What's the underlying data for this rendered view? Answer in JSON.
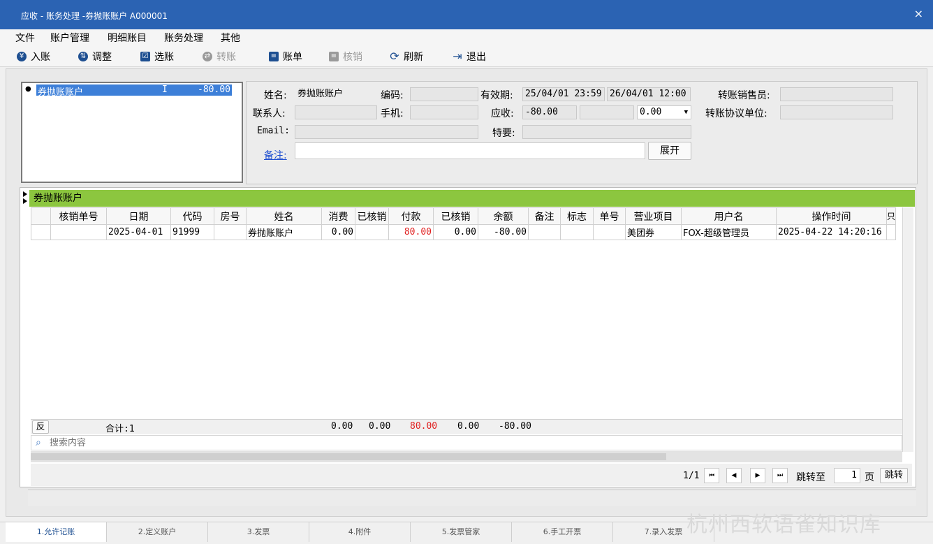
{
  "window": {
    "title": "应收 - 账务处理 -券抛账账户 A000001",
    "close": "×"
  },
  "menu": [
    "文件",
    "账户管理",
    "明细账目",
    "账务处理",
    "其他"
  ],
  "toolbar": [
    {
      "label": "入账",
      "glyph": "¥",
      "enabled": true
    },
    {
      "label": "调整",
      "glyph": "⇅",
      "enabled": true
    },
    {
      "label": "选账",
      "glyph": "☑",
      "enabled": true
    },
    {
      "label": "转账",
      "glyph": "⇄",
      "enabled": false
    },
    {
      "label": "账单",
      "glyph": "≡",
      "enabled": true
    },
    {
      "label": "核销",
      "glyph": "≡",
      "enabled": false
    },
    {
      "label": "刷新",
      "glyph": "⟳",
      "enabled": true
    },
    {
      "label": "退出",
      "glyph": "⇥",
      "enabled": true
    }
  ],
  "account_list": {
    "name": "券抛账账户",
    "flag": "I",
    "balance": "-80.00",
    "bullet": "●"
  },
  "info": {
    "name_label": "姓名:",
    "name_value": "券抛账账户",
    "code_label": "编码:",
    "code_value": "",
    "valid_label": "有效期:",
    "valid_from": "25/04/01 23:59",
    "valid_to": "26/04/01 12:00",
    "sales_label": "转账销售员:",
    "sales_value": "",
    "contact_label": "联系人:",
    "contact_value": "",
    "phone_label": "手机:",
    "phone_value": "",
    "receivable_label": "应收:",
    "receivable_value": "-80.00",
    "receivable_extra": "",
    "receivable_select": "0.00",
    "agreement_label": "转账协议单位:",
    "agreement_value": "",
    "email_label": "Email:",
    "email_value": "",
    "special_label": "特要:",
    "special_value": "",
    "remark_label": "备注:",
    "remark_value": "",
    "expand_button": "展开"
  },
  "grid": {
    "title": "券抛账账户",
    "columns": [
      "",
      "核销单号",
      "日期",
      "代码",
      "房号",
      "姓名",
      "消费",
      "已核销",
      "付款",
      "已核销",
      "余额",
      "备注",
      "标志",
      "单号",
      "营业项目",
      "用户名",
      "操作时间",
      "只"
    ],
    "rows": [
      [
        "",
        "",
        "2025-04-01",
        "91999",
        "",
        "券抛账账户",
        "0.00",
        "",
        "80.00",
        "0.00",
        "-80.00",
        "",
        "",
        "",
        "美团券",
        "FOX-超级管理员",
        "2025-04-22 14:20:16",
        ""
      ]
    ]
  },
  "summary": {
    "reverse": "反",
    "total": "合计:1",
    "consume": "0.00",
    "written_off1": "0.00",
    "payment": "80.00",
    "written_off2": "0.00",
    "balance": "-80.00"
  },
  "search": {
    "placeholder": "搜索内容"
  },
  "pager": {
    "page": "1/1",
    "jump_label": "跳转至",
    "page_input": "1",
    "page_unit": "页",
    "jump_button": "跳转"
  },
  "tabs": [
    "1.允许记账",
    "2.定义账户",
    "3.发票",
    "4.附件",
    "5.发票管家",
    "6.手工开票",
    "7.录入发票"
  ],
  "watermark": "杭州西软语雀知识库",
  "colors": {
    "title_bar": "#2b63b3",
    "grid_header": "#8cc63f",
    "selection": "#3d7fd8",
    "negative_red": "#e02020"
  }
}
